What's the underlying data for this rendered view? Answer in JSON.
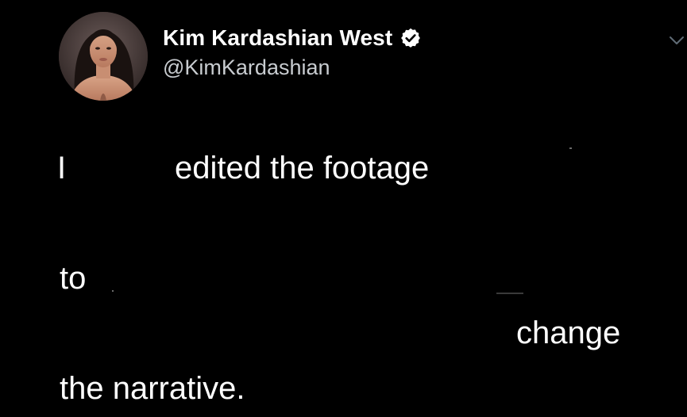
{
  "tweet": {
    "author": {
      "display_name": "Kim Kardashian West",
      "handle": "@KimKardashian",
      "verified": true,
      "avatar_icon": "profile-photo"
    },
    "menu_icon": "chevron-down-icon",
    "text_fragments": [
      "I",
      "edited the footage",
      "to",
      "change",
      "the narrative."
    ]
  },
  "colors": {
    "background": "#000000",
    "text": "#ffffff",
    "handle": "#c8ccd0",
    "verified_badge": "#ffffff",
    "chevron": "#5f6b75"
  }
}
